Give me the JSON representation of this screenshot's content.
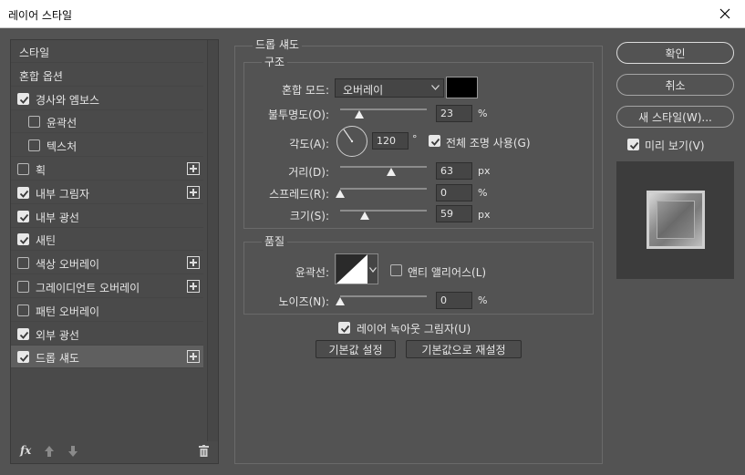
{
  "window": {
    "title": "레이어 스타일"
  },
  "left": {
    "items": [
      {
        "label": "스타일",
        "checkbox": false,
        "checked": false,
        "plus": false,
        "indent": false
      },
      {
        "label": "혼합 옵션",
        "checkbox": false,
        "checked": false,
        "plus": false,
        "indent": false
      },
      {
        "label": "경사와 엠보스",
        "checkbox": true,
        "checked": true,
        "plus": false,
        "indent": false
      },
      {
        "label": "윤곽선",
        "checkbox": true,
        "checked": false,
        "plus": false,
        "indent": true
      },
      {
        "label": "텍스처",
        "checkbox": true,
        "checked": false,
        "plus": false,
        "indent": true
      },
      {
        "label": "획",
        "checkbox": true,
        "checked": false,
        "plus": true,
        "indent": false
      },
      {
        "label": "내부 그림자",
        "checkbox": true,
        "checked": true,
        "plus": true,
        "indent": false
      },
      {
        "label": "내부 광선",
        "checkbox": true,
        "checked": true,
        "plus": false,
        "indent": false
      },
      {
        "label": "새틴",
        "checkbox": true,
        "checked": true,
        "plus": false,
        "indent": false
      },
      {
        "label": "색상 오버레이",
        "checkbox": true,
        "checked": false,
        "plus": true,
        "indent": false
      },
      {
        "label": "그레이디언트 오버레이",
        "checkbox": true,
        "checked": false,
        "plus": true,
        "indent": false
      },
      {
        "label": "패턴 오버레이",
        "checkbox": true,
        "checked": false,
        "plus": false,
        "indent": false
      },
      {
        "label": "외부 광선",
        "checkbox": true,
        "checked": true,
        "plus": false,
        "indent": false
      },
      {
        "label": "드롭 섀도",
        "checkbox": true,
        "checked": true,
        "plus": true,
        "indent": false,
        "selected": true
      }
    ],
    "footer": {
      "fx": "fx",
      "up_icon": "arrow-up-icon",
      "down_icon": "arrow-down-icon",
      "trash_icon": "trash-icon"
    }
  },
  "panel": {
    "title": "드롭 섀도",
    "structure": {
      "title": "구조",
      "blend_mode_label": "혼합 모드:",
      "blend_mode_value": "오버레이",
      "shadow_color": "#000000",
      "opacity_label": "불투명도(O):",
      "opacity_value": "23",
      "opacity_unit": "%",
      "angle_label": "각도(A):",
      "angle_value": "120",
      "angle_unit": "°",
      "global_light_label": "전체 조명 사용(G)",
      "global_light_checked": true,
      "distance_label": "거리(D):",
      "distance_value": "63",
      "distance_unit": "px",
      "spread_label": "스프레드(R):",
      "spread_value": "0",
      "spread_unit": "%",
      "size_label": "크기(S):",
      "size_value": "59",
      "size_unit": "px"
    },
    "quality": {
      "title": "품질",
      "contour_label": "윤곽선:",
      "antialias_label": "앤티 앨리어스(L)",
      "antialias_checked": false,
      "noise_label": "노이즈(N):",
      "noise_value": "0",
      "noise_unit": "%"
    },
    "knockout_label": "레이어 녹아웃 그림자(U)",
    "knockout_checked": true,
    "make_default": "기본값 설정",
    "reset_default": "기본값으로 재설정"
  },
  "buttons": {
    "ok": "확인",
    "cancel": "취소",
    "new_style": "새 스타일(W)...",
    "preview_label": "미리 보기(V)",
    "preview_checked": true
  }
}
